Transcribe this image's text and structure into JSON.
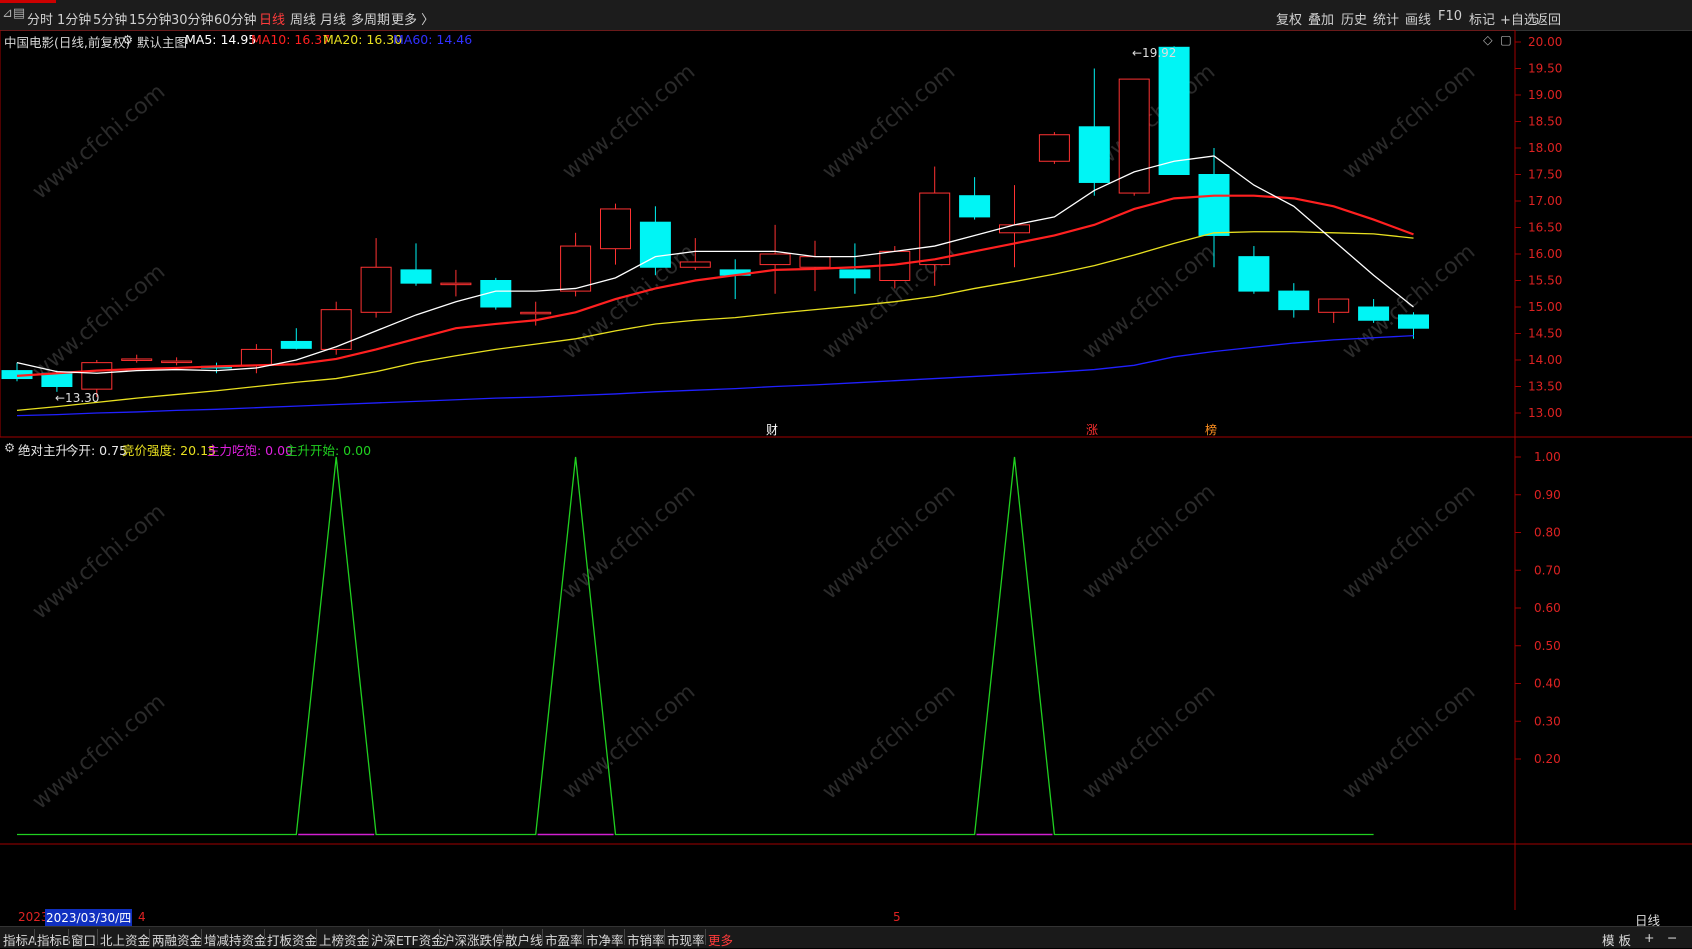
{
  "toolbar": {
    "left_icon": "collapse-icon",
    "periods": [
      "分时",
      "1分钟",
      "5分钟",
      "15分钟",
      "30分钟",
      "60分钟",
      "日线",
      "周线",
      "月线",
      "多周期",
      "更多 〉"
    ],
    "active_period": "日线",
    "right_buttons": [
      "复权",
      "叠加",
      "历史",
      "统计",
      "画线",
      "F10",
      "标记",
      "+自选",
      "返回"
    ]
  },
  "main_title": {
    "stock": "中国电影(日线,前复权)",
    "template": "默认主图",
    "ma5": "MA5: 14.95",
    "ma10": "MA10: 16.37",
    "ma20": "MA20: 16.30",
    "ma60": "MA60: 14.46",
    "colors": {
      "ma5": "#ffffff",
      "ma10": "#ff2020",
      "ma20": "#e8e020",
      "ma60": "#2020ff"
    }
  },
  "main_axis": {
    "ticks": [
      "20.00",
      "19.50",
      "19.00",
      "18.50",
      "18.00",
      "17.50",
      "17.00",
      "16.50",
      "16.00",
      "15.50",
      "15.00",
      "14.50",
      "14.00",
      "13.50",
      "13.00"
    ]
  },
  "annotations": {
    "high": "19.92",
    "low": "←13.30",
    "event_markers": [
      "财",
      "涨",
      "榜"
    ]
  },
  "candles": [
    {
      "o": 13.8,
      "h": 13.95,
      "l": 13.6,
      "c": 13.65
    },
    {
      "o": 13.75,
      "h": 13.8,
      "l": 13.4,
      "c": 13.5
    },
    {
      "o": 13.45,
      "h": 14.0,
      "l": 13.3,
      "c": 13.95
    },
    {
      "o": 14.0,
      "h": 14.1,
      "l": 13.95,
      "c": 14.02
    },
    {
      "o": 13.98,
      "h": 14.05,
      "l": 13.9,
      "c": 13.98
    },
    {
      "o": 13.88,
      "h": 13.95,
      "l": 13.75,
      "c": 13.85
    },
    {
      "o": 13.9,
      "h": 14.3,
      "l": 13.75,
      "c": 14.2
    },
    {
      "o": 14.35,
      "h": 14.6,
      "l": 14.2,
      "c": 14.22
    },
    {
      "o": 14.2,
      "h": 15.1,
      "l": 14.1,
      "c": 14.95
    },
    {
      "o": 14.9,
      "h": 16.3,
      "l": 14.8,
      "c": 15.75
    },
    {
      "o": 15.7,
      "h": 16.2,
      "l": 15.4,
      "c": 15.45
    },
    {
      "o": 15.45,
      "h": 15.7,
      "l": 15.2,
      "c": 15.45
    },
    {
      "o": 15.5,
      "h": 15.55,
      "l": 14.95,
      "c": 15.0
    },
    {
      "o": 14.9,
      "h": 15.1,
      "l": 14.65,
      "c": 14.9
    },
    {
      "o": 15.3,
      "h": 16.4,
      "l": 15.2,
      "c": 16.15
    },
    {
      "o": 16.1,
      "h": 16.95,
      "l": 15.8,
      "c": 16.85
    },
    {
      "o": 16.6,
      "h": 16.9,
      "l": 15.6,
      "c": 15.75
    },
    {
      "o": 15.75,
      "h": 16.3,
      "l": 15.7,
      "c": 15.85
    },
    {
      "o": 15.7,
      "h": 15.9,
      "l": 15.15,
      "c": 15.6
    },
    {
      "o": 15.8,
      "h": 16.55,
      "l": 15.25,
      "c": 16.0
    },
    {
      "o": 15.75,
      "h": 16.25,
      "l": 15.3,
      "c": 15.95
    },
    {
      "o": 15.7,
      "h": 16.2,
      "l": 15.25,
      "c": 15.55
    },
    {
      "o": 15.5,
      "h": 16.15,
      "l": 15.35,
      "c": 16.05
    },
    {
      "o": 15.8,
      "h": 17.65,
      "l": 15.4,
      "c": 17.15
    },
    {
      "o": 17.1,
      "h": 17.45,
      "l": 16.65,
      "c": 16.7
    },
    {
      "o": 16.4,
      "h": 17.3,
      "l": 15.75,
      "c": 16.55
    },
    {
      "o": 17.75,
      "h": 18.3,
      "l": 17.7,
      "c": 18.25
    },
    {
      "o": 18.4,
      "h": 19.5,
      "l": 17.1,
      "c": 17.35
    },
    {
      "o": 17.15,
      "h": 19.3,
      "l": 17.1,
      "c": 19.3
    },
    {
      "o": 19.9,
      "h": 19.92,
      "l": 17.5,
      "c": 17.5
    },
    {
      "o": 17.5,
      "h": 18.0,
      "l": 15.75,
      "c": 16.35
    },
    {
      "o": 15.95,
      "h": 16.15,
      "l": 15.25,
      "c": 15.3
    },
    {
      "o": 15.3,
      "h": 15.45,
      "l": 14.8,
      "c": 14.95
    },
    {
      "o": 14.9,
      "h": 15.15,
      "l": 14.7,
      "c": 15.15
    },
    {
      "o": 15.0,
      "h": 15.15,
      "l": 14.7,
      "c": 14.75
    },
    {
      "o": 14.85,
      "h": 14.9,
      "l": 14.4,
      "c": 14.6
    }
  ],
  "ma_lines": {
    "ma5": [
      13.95,
      13.78,
      13.75,
      13.8,
      13.82,
      13.8,
      13.85,
      14.0,
      14.25,
      14.55,
      14.85,
      15.1,
      15.3,
      15.3,
      15.35,
      15.55,
      15.95,
      16.05,
      16.05,
      16.05,
      15.95,
      15.95,
      16.05,
      16.15,
      16.35,
      16.55,
      16.7,
      17.2,
      17.55,
      17.75,
      17.85,
      17.3,
      16.9,
      16.25,
      15.6,
      15.0
    ],
    "ma10": [
      13.7,
      13.75,
      13.8,
      13.83,
      13.85,
      13.88,
      13.9,
      13.92,
      14.02,
      14.2,
      14.4,
      14.6,
      14.68,
      14.75,
      14.9,
      15.15,
      15.35,
      15.5,
      15.6,
      15.7,
      15.72,
      15.75,
      15.8,
      15.9,
      16.05,
      16.2,
      16.35,
      16.55,
      16.85,
      17.05,
      17.1,
      17.1,
      17.05,
      16.9,
      16.65,
      16.37
    ],
    "ma20": [
      13.05,
      13.12,
      13.2,
      13.28,
      13.35,
      13.42,
      13.5,
      13.58,
      13.65,
      13.78,
      13.95,
      14.08,
      14.2,
      14.3,
      14.4,
      14.55,
      14.68,
      14.75,
      14.8,
      14.88,
      14.95,
      15.02,
      15.1,
      15.2,
      15.35,
      15.48,
      15.62,
      15.78,
      15.98,
      16.2,
      16.4,
      16.42,
      16.42,
      16.4,
      16.38,
      16.3
    ],
    "ma60": [
      12.95,
      12.97,
      13.0,
      13.02,
      13.05,
      13.07,
      13.1,
      13.13,
      13.16,
      13.19,
      13.22,
      13.25,
      13.28,
      13.3,
      13.33,
      13.36,
      13.4,
      13.43,
      13.46,
      13.5,
      13.53,
      13.57,
      13.61,
      13.65,
      13.69,
      13.73,
      13.77,
      13.82,
      13.9,
      14.06,
      14.16,
      14.24,
      14.32,
      14.38,
      14.42,
      14.46
    ]
  },
  "sub_title": {
    "name": "绝对主升",
    "today_open": "今开: 0.75",
    "bid_strength": "竞价强度: 20.15",
    "main_force": "主力吃饱: 0.00",
    "main_rise": "主升开始: 0.00",
    "colors": {
      "bid_strength": "#e8e020",
      "main_force": "#e020e0",
      "main_rise": "#20d020"
    }
  },
  "sub_axis": {
    "ticks": [
      "1.00",
      "0.90",
      "0.80",
      "0.70",
      "0.60",
      "0.50",
      "0.40",
      "0.30",
      "0.20"
    ]
  },
  "chart_data": [
    {
      "type": "line",
      "title": "中国电影(日线,前复权)",
      "series_note": "candlestick with MA5/MA10/MA20/MA60",
      "ylim": [
        12.8,
        20.1
      ]
    },
    {
      "type": "line",
      "title": "绝对主升",
      "series": [
        {
          "name": "主升开始",
          "values": [
            0,
            0,
            0,
            0,
            0,
            0,
            0,
            0,
            1,
            0,
            0,
            0,
            0,
            0,
            1,
            0,
            0,
            0,
            0,
            0,
            0,
            0,
            0,
            0,
            0,
            1,
            0,
            0,
            0,
            0,
            0,
            0,
            0,
            0,
            0
          ]
        }
      ],
      "ylim": [
        0,
        1.05
      ]
    }
  ],
  "date_bar": {
    "year": "2023",
    "date": "2023/03/30/四",
    "month4": "4",
    "month5": "5"
  },
  "bottom_tabs": [
    "指标A",
    "指标B",
    "窗口",
    "北上资金",
    "两融资金",
    "增减持资金",
    "打板资金",
    "上榜资金",
    "沪深ETF资金",
    "沪深涨跌停",
    "散户线",
    "市盈率",
    "市净率",
    "市销率",
    "市现率",
    "更多"
  ],
  "bottom_right": {
    "template": "模 板",
    "plus": "+",
    "minus": "−",
    "period": "日线"
  },
  "watermark": "www.cfchi.com"
}
